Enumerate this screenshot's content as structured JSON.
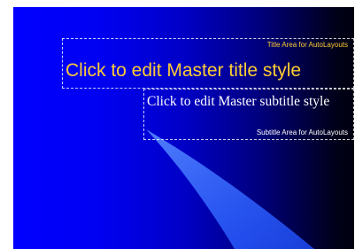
{
  "slide": {
    "title_area": {
      "caption": "Title Area for AutoLayouts",
      "text": "Click to edit Master title style"
    },
    "subtitle_area": {
      "caption": "Subtitle Area for AutoLayouts",
      "text": "Click to edit Master subtitle style"
    }
  },
  "colors": {
    "background_left": "#0000ff",
    "background_right": "#000010",
    "title_text": "#ffcc33",
    "subtitle_text": "#ffffff",
    "swoosh": "#3366ff"
  }
}
